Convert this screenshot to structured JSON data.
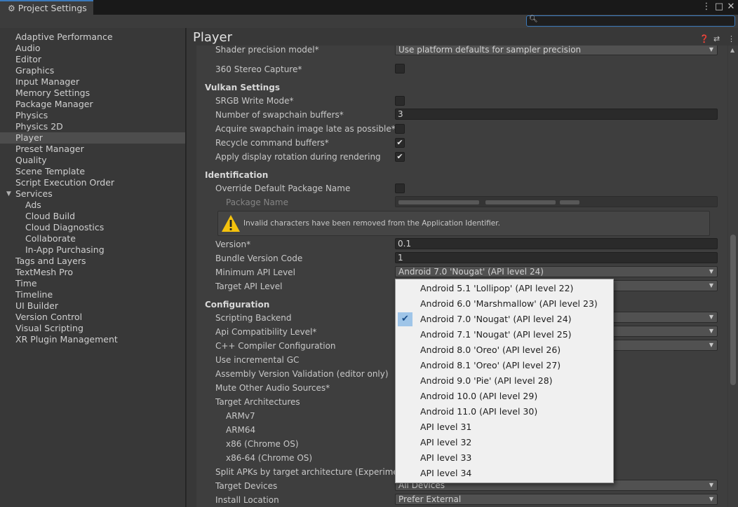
{
  "window": {
    "tab_title": "Project Settings",
    "controls": [
      "⋮",
      "□",
      "✕"
    ]
  },
  "search": {
    "placeholder": "",
    "value": ""
  },
  "sidebar": {
    "items": [
      {
        "label": "Adaptive Performance",
        "indent": 0
      },
      {
        "label": "Audio",
        "indent": 0
      },
      {
        "label": "Editor",
        "indent": 0
      },
      {
        "label": "Graphics",
        "indent": 0
      },
      {
        "label": "Input Manager",
        "indent": 0
      },
      {
        "label": "Memory Settings",
        "indent": 0
      },
      {
        "label": "Package Manager",
        "indent": 0
      },
      {
        "label": "Physics",
        "indent": 0
      },
      {
        "label": "Physics 2D",
        "indent": 0
      },
      {
        "label": "Player",
        "indent": 0,
        "selected": true
      },
      {
        "label": "Preset Manager",
        "indent": 0
      },
      {
        "label": "Quality",
        "indent": 0
      },
      {
        "label": "Scene Template",
        "indent": 0
      },
      {
        "label": "Script Execution Order",
        "indent": 0
      },
      {
        "label": "Services",
        "indent": 0,
        "expanded": true
      },
      {
        "label": "Ads",
        "indent": 1
      },
      {
        "label": "Cloud Build",
        "indent": 1
      },
      {
        "label": "Cloud Diagnostics",
        "indent": 1
      },
      {
        "label": "Collaborate",
        "indent": 1
      },
      {
        "label": "In-App Purchasing",
        "indent": 1
      },
      {
        "label": "Tags and Layers",
        "indent": 0
      },
      {
        "label": "TextMesh Pro",
        "indent": 0
      },
      {
        "label": "Time",
        "indent": 0
      },
      {
        "label": "Timeline",
        "indent": 0
      },
      {
        "label": "UI Builder",
        "indent": 0
      },
      {
        "label": "Version Control",
        "indent": 0
      },
      {
        "label": "Visual Scripting",
        "indent": 0
      },
      {
        "label": "XR Plugin Management",
        "indent": 0
      }
    ]
  },
  "header": {
    "title": "Player",
    "icons": [
      "help-icon",
      "preset-icon",
      "more-icon"
    ]
  },
  "settings": {
    "shader_precision_label": "Shader precision model*",
    "shader_precision_value": "Use platform defaults for sampler precision",
    "stereo_capture_label": "360 Stereo Capture*",
    "stereo_capture_checked": false,
    "vulkan_section": "Vulkan Settings",
    "srgb_label": "SRGB Write Mode*",
    "srgb_checked": false,
    "swapchain_label": "Number of swapchain buffers*",
    "swapchain_value": "3",
    "acquire_label": "Acquire swapchain image late as possible*",
    "acquire_checked": false,
    "recycle_label": "Recycle command buffers*",
    "recycle_checked": true,
    "rotation_label": "Apply display rotation during rendering",
    "rotation_checked": true,
    "identification_section": "Identification",
    "override_label": "Override Default Package Name",
    "override_checked": false,
    "package_name_label": "Package Name",
    "warning_text": "Invalid characters have been removed from the Application Identifier.",
    "version_label": "Version*",
    "version_value": "0.1",
    "bundle_label": "Bundle Version Code",
    "bundle_value": "1",
    "min_api_label": "Minimum API Level",
    "min_api_value": "Android 7.0 'Nougat' (API level 24)",
    "target_api_label": "Target API Level",
    "configuration_section": "Configuration",
    "scripting_backend_label": "Scripting Backend",
    "api_compat_label": "Api Compatibility Level*",
    "cpp_config_label": "C++ Compiler Configuration",
    "incremental_gc_label": "Use incremental GC",
    "assembly_validation_label": "Assembly Version Validation (editor only)",
    "mute_audio_label": "Mute Other Audio Sources*",
    "target_arch_label": "Target Architectures",
    "armv7_label": "ARMv7",
    "arm64_label": "ARM64",
    "x86_label": "x86 (Chrome OS)",
    "x8664_label": "x86-64 (Chrome OS)",
    "split_apks_label": "Split APKs by target architecture (Experimental)",
    "target_devices_label": "Target Devices",
    "target_devices_value": "All Devices",
    "install_location_label": "Install Location",
    "install_location_value": "Prefer External"
  },
  "popup": {
    "items": [
      {
        "label": "Android 5.1 'Lollipop' (API level 22)",
        "selected": false
      },
      {
        "label": "Android 6.0 'Marshmallow' (API level 23)",
        "selected": false
      },
      {
        "label": "Android 7.0 'Nougat' (API level 24)",
        "selected": true
      },
      {
        "label": "Android 7.1 'Nougat' (API level 25)",
        "selected": false
      },
      {
        "label": "Android 8.0 'Oreo' (API level 26)",
        "selected": false
      },
      {
        "label": "Android 8.1 'Oreo' (API level 27)",
        "selected": false
      },
      {
        "label": "Android 9.0 'Pie' (API level 28)",
        "selected": false
      },
      {
        "label": "Android 10.0 (API level 29)",
        "selected": false
      },
      {
        "label": "Android 11.0 (API level 30)",
        "selected": false
      },
      {
        "label": "API level 31",
        "selected": false
      },
      {
        "label": "API level 32",
        "selected": false
      },
      {
        "label": "API level 33",
        "selected": false
      },
      {
        "label": "API level 34",
        "selected": false
      }
    ]
  },
  "colors": {
    "accent": "#3a79bb",
    "selection": "#9fc5e8",
    "warning": "#f4c20d"
  }
}
